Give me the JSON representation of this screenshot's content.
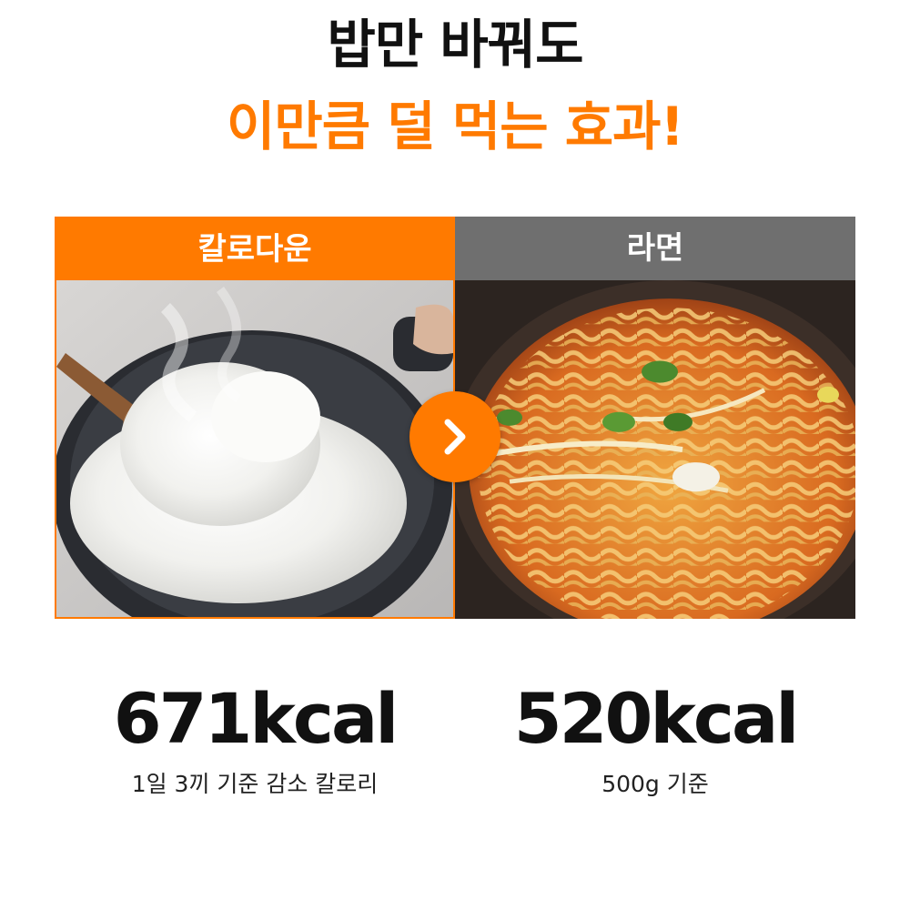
{
  "headline": {
    "line1": "밥만 바꿔도",
    "line2": "이만큼 덜 먹는 효과!"
  },
  "colors": {
    "accent": "#ff7a00",
    "secondary_header": "#6f6f6f",
    "text": "#111111"
  },
  "comparison": {
    "left": {
      "label": "칼로다운",
      "image": "rice-in-pot-photo",
      "kcal": "671kcal",
      "caption": "1일 3끼 기준 감소 칼로리"
    },
    "arrow_icon": "chevron-right-icon",
    "right": {
      "label": "라면",
      "image": "ramen-photo",
      "kcal": "520kcal",
      "caption": "500g 기준"
    }
  }
}
